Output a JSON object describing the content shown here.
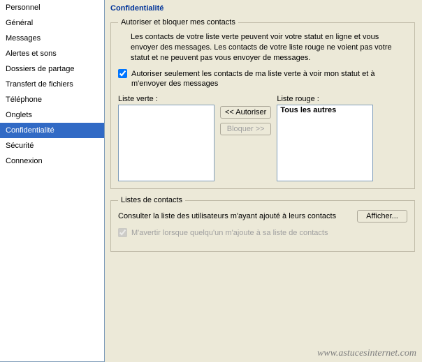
{
  "sidebar": {
    "items": [
      {
        "label": "Personnel"
      },
      {
        "label": "Général"
      },
      {
        "label": "Messages"
      },
      {
        "label": "Alertes et sons"
      },
      {
        "label": "Dossiers de partage"
      },
      {
        "label": "Transfert de fichiers"
      },
      {
        "label": "Téléphone"
      },
      {
        "label": "Onglets"
      },
      {
        "label": "Confidentialité"
      },
      {
        "label": "Sécurité"
      },
      {
        "label": "Connexion"
      }
    ],
    "selected_index": 8
  },
  "main": {
    "title": "Confidentialité",
    "group_allow": {
      "legend": "Autoriser et bloquer mes contacts",
      "description": "Les contacts de votre liste verte peuvent voir votre statut en ligne et vous envoyer des messages. Les contacts de votre liste rouge ne voient pas votre statut et ne peuvent pas vous envoyer de messages.",
      "checkbox_green_only": "Autoriser seulement les contacts de ma liste verte à voir mon statut et à m'envoyer des messages",
      "checkbox_green_only_checked": true,
      "green_label": "Liste verte :",
      "red_label": "Liste rouge :",
      "red_items": [
        "Tous les autres"
      ],
      "btn_authorize": "<< Autoriser",
      "btn_block": "Bloquer >>"
    },
    "group_contacts": {
      "legend": "Listes de contacts",
      "consult_text": "Consulter la liste des utilisateurs m'ayant ajouté à leurs contacts",
      "btn_view": "Afficher...",
      "notify_text": "M'avertir lorsque quelqu'un m'ajoute à sa liste de contacts",
      "notify_checked": true,
      "notify_disabled": true
    }
  },
  "watermark": "www.astucesinternet.com"
}
